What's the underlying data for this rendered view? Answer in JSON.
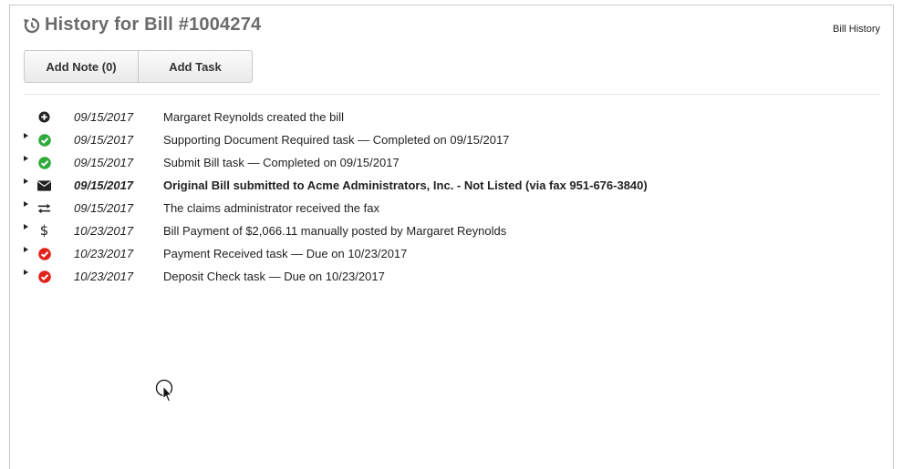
{
  "header": {
    "title": "History for Bill #1004274",
    "breadcrumb": "Bill History"
  },
  "actions": {
    "add_note_label": "Add Note (0)",
    "add_task_label": "Add Task"
  },
  "history": [
    {
      "icon": "plus-circle-icon",
      "date": "09/15/2017",
      "text": "Margaret Reynolds created the bill",
      "expandable": false,
      "bold": false
    },
    {
      "icon": "check-circle-green-icon",
      "date": "09/15/2017",
      "text": "Supporting Document Required task — Completed on 09/15/2017",
      "expandable": true,
      "bold": false
    },
    {
      "icon": "check-circle-green-icon",
      "date": "09/15/2017",
      "text": "Submit Bill task — Completed on 09/15/2017",
      "expandable": true,
      "bold": false
    },
    {
      "icon": "envelope-icon",
      "date": "09/15/2017",
      "text": "Original Bill submitted to Acme Administrators, Inc. - Not Listed (via fax 951-676-3840)",
      "expandable": true,
      "bold": true
    },
    {
      "icon": "exchange-arrows-icon",
      "date": "09/15/2017",
      "text": "The claims administrator received the fax",
      "expandable": true,
      "bold": false
    },
    {
      "icon": "dollar-icon",
      "date": "10/23/2017",
      "text": "Bill Payment of $2,066.11 manually posted by Margaret Reynolds",
      "expandable": true,
      "bold": false
    },
    {
      "icon": "check-circle-red-icon",
      "date": "10/23/2017",
      "text": "Payment Received task — Due on 10/23/2017",
      "expandable": true,
      "bold": false
    },
    {
      "icon": "check-circle-red-icon",
      "date": "10/23/2017",
      "text": "Deposit Check task — Due on 10/23/2017",
      "expandable": true,
      "bold": false
    }
  ],
  "colors": {
    "green": "#2eaa3a",
    "red": "#e0221c",
    "title_gray": "#6b6b6b"
  }
}
